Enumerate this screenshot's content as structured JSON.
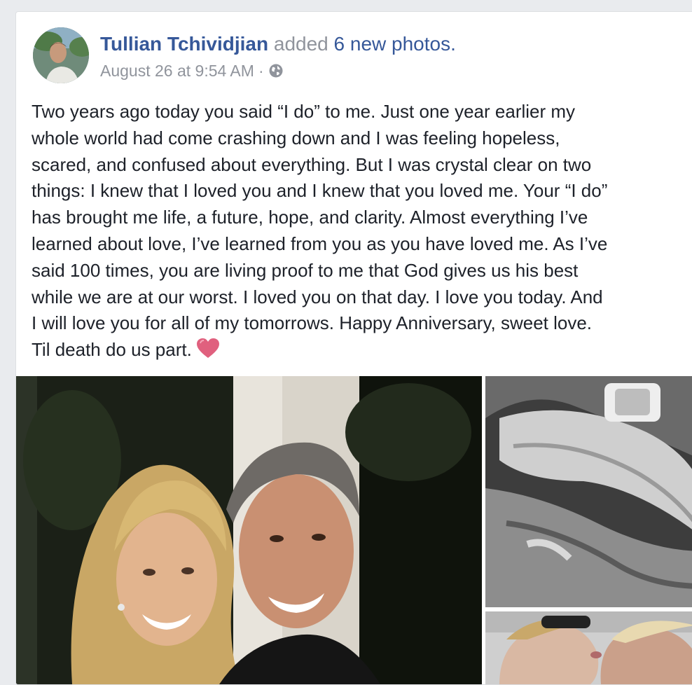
{
  "post": {
    "author_name": "Tullian Tchividjian",
    "action_text": "added",
    "photos_link": "6 new photos.",
    "timestamp": "August 26 at 9:54 AM",
    "separator": "·",
    "privacy_icon": "globe-icon",
    "text_lines": [
      "Two years ago today you said “I do” to me. Just one year earlier my",
      "whole world had come crashing down and I was feeling hopeless,",
      "scared, and confused about everything. But I was crystal clear on two",
      "things: I knew that I loved you and I knew that you loved me. Your “I do”",
      "has brought me life, a future, hope, and clarity. Almost everything I’ve",
      "learned about love, I’ve learned from you as you have loved me. As I’ve",
      "said 100 times, you are living proof to me that God gives us his best",
      "while we are at our worst. I loved you on that day. I love you today. And",
      "I will love you for all of my tomorrows. Happy Anniversary, sweet love.",
      "Til death do us part."
    ],
    "emoji": "heart-emoji"
  },
  "colors": {
    "link": "#365899",
    "meta": "#90949c",
    "text": "#1d2129",
    "heart": "#e0607e",
    "page_bg": "#e9ebee"
  }
}
